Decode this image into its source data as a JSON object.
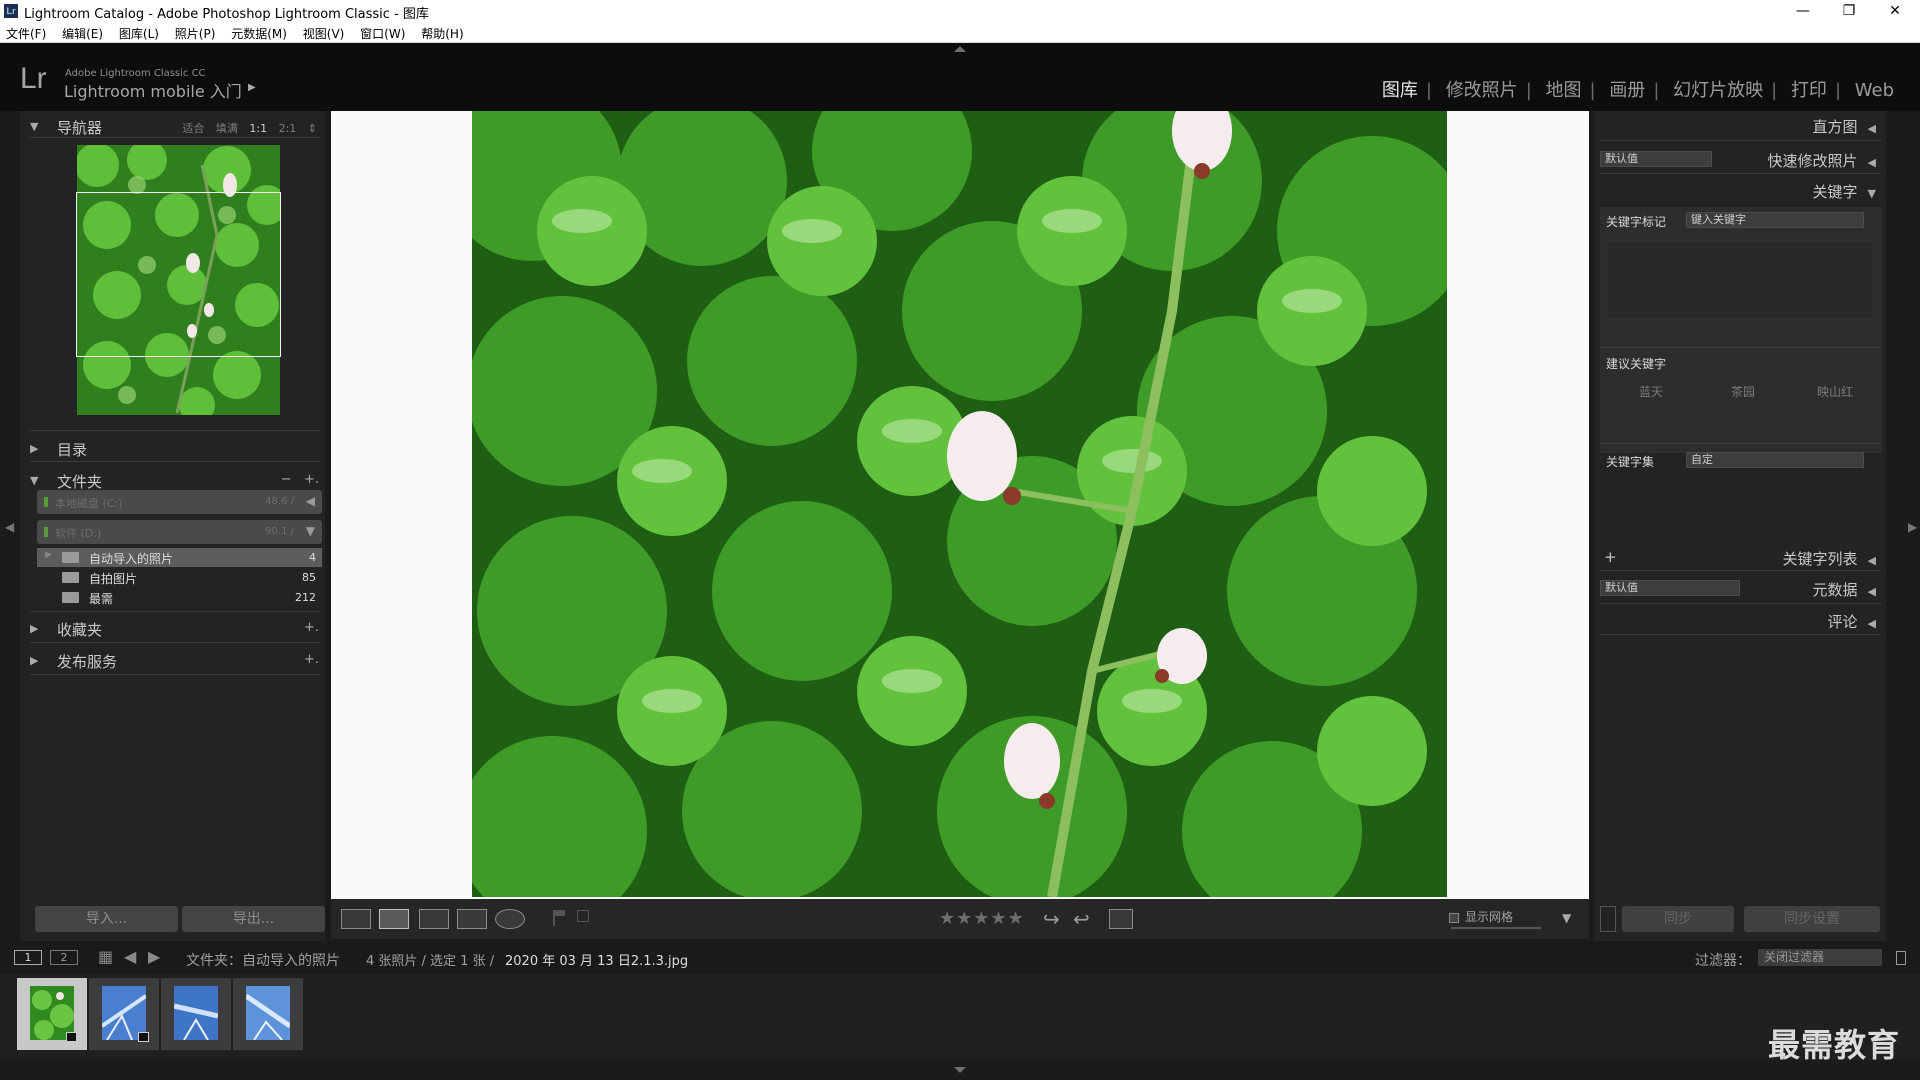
{
  "window": {
    "icon": "Lr",
    "title": "Lightroom Catalog - Adobe Photoshop Lightroom Classic - 图库",
    "minimize": "—",
    "maximize": "❐",
    "close": "✕"
  },
  "menu": [
    "文件(F)",
    "编辑(E)",
    "图库(L)",
    "照片(P)",
    "元数据(M)",
    "视图(V)",
    "窗口(W)",
    "帮助(H)"
  ],
  "identity": {
    "logo": "Lr",
    "product": "Adobe Lightroom Classic CC",
    "mobile": "Lightroom mobile 入门",
    "arrow": "▶"
  },
  "modules": [
    {
      "label": "图库",
      "active": true
    },
    {
      "label": "修改照片",
      "active": false
    },
    {
      "label": "地图",
      "active": false
    },
    {
      "label": "画册",
      "active": false
    },
    {
      "label": "幻灯片放映",
      "active": false
    },
    {
      "label": "打印",
      "active": false
    },
    {
      "label": "Web",
      "active": false
    }
  ],
  "left": {
    "navigator": {
      "title": "导航器",
      "options": [
        "适合",
        "填满",
        "1:1",
        "2:1"
      ],
      "active_option": "1:1",
      "stepper": "⇕"
    },
    "catalog": {
      "title": "目录"
    },
    "folders": {
      "title": "文件夹",
      "minus": "−",
      "plus": "+.",
      "volumes": [
        {
          "name": "本地磁盘 (C:)",
          "size": "48.6 /",
          "icon": "◀"
        },
        {
          "name": "软件 (D:)",
          "size": "90.1 /",
          "icon": "▼"
        }
      ],
      "items": [
        {
          "name": "自动导入的照片",
          "count": "4",
          "selected": true
        },
        {
          "name": "自拍图片",
          "count": "85",
          "selected": false
        },
        {
          "name": "最需",
          "count": "212",
          "selected": false
        }
      ]
    },
    "collections": {
      "title": "收藏夹",
      "plus": "+."
    },
    "publish": {
      "title": "发布服务",
      "plus": "+."
    },
    "import_label": "导入...",
    "export_label": "导出..."
  },
  "toolbar": {
    "stars": "★★★★★",
    "show_grid": "显示网格"
  },
  "right": {
    "histogram": "直方图",
    "quick_develop": "快速修改照片",
    "quick_preset": "默认值",
    "keywording": "关键字",
    "kw_tags_label": "关键字标记",
    "kw_tags_select": "键入关键字",
    "suggested_label": "建议关键字",
    "suggested": [
      "蓝天",
      "茶园",
      "映山红"
    ],
    "kw_set_label": "关键字集",
    "kw_set_select": "自定",
    "keyword_list": "关键字列表",
    "keyword_list_plus": "+",
    "metadata": "元数据",
    "metadata_preset": "默认值",
    "comments": "评论",
    "sync_label": "同步",
    "sync_settings_label": "同步设置"
  },
  "filmstrip_bar": {
    "page1": "1",
    "page2": "2",
    "path_prefix": "文件夹：自动导入的照片",
    "count_text": "4 张照片 / 选定 1 张 /",
    "filename": "2020 年 03 月 13 日2.1.3.jpg",
    "filter_label": "过滤器：",
    "filter_value": "关闭过滤器"
  },
  "watermark": "最需教育"
}
